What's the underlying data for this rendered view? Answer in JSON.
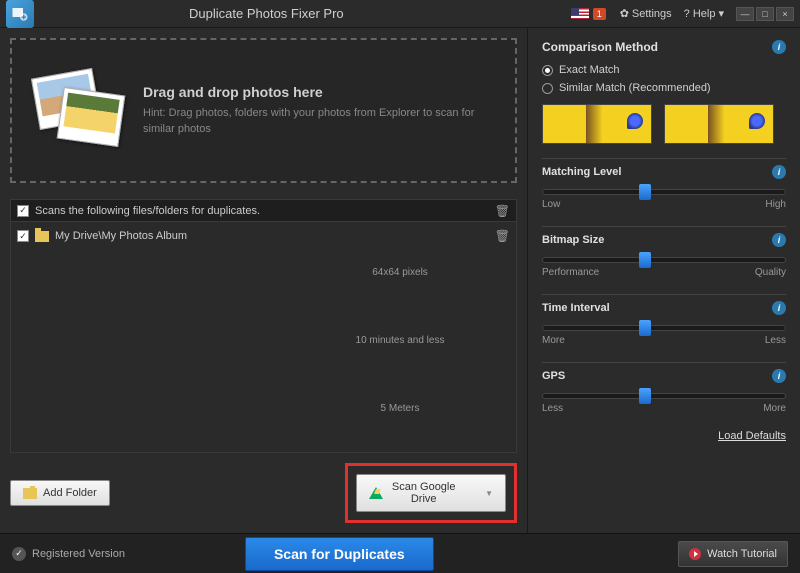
{
  "titlebar": {
    "app_title": "Duplicate Photos Fixer Pro",
    "notification_count": "1",
    "settings_label": "Settings",
    "help_label": "? Help",
    "minimize": "—",
    "maximize": "□",
    "close": "×"
  },
  "dropzone": {
    "heading": "Drag and drop photos here",
    "hint": "Hint: Drag photos, folders with your photos from Explorer to scan for similar photos"
  },
  "filelist": {
    "header": "Scans the following files/folders for duplicates.",
    "items": [
      {
        "path": "My Drive\\My Photos Album",
        "checked": true
      }
    ]
  },
  "buttons": {
    "add_folder": "Add Folder",
    "scan_gdrive": "Scan Google Drive",
    "scan_duplicates": "Scan for Duplicates",
    "watch_tutorial": "Watch Tutorial"
  },
  "sidebar": {
    "comparison_method": "Comparison Method",
    "exact_match": "Exact Match",
    "similar_match": "Similar Match (Recommended)",
    "matching_level": {
      "title": "Matching Level",
      "left": "Low",
      "right": "High",
      "pos": 42
    },
    "bitmap_size": {
      "title": "Bitmap Size",
      "left": "Performance",
      "right": "Quality",
      "center": "64x64 pixels",
      "pos": 42
    },
    "time_interval": {
      "title": "Time Interval",
      "left": "More",
      "right": "Less",
      "center": "10 minutes and less",
      "pos": 42
    },
    "gps": {
      "title": "GPS",
      "left": "Less",
      "right": "More",
      "center": "5 Meters",
      "pos": 42
    },
    "load_defaults": "Load Defaults"
  },
  "footer": {
    "registered": "Registered Version"
  }
}
